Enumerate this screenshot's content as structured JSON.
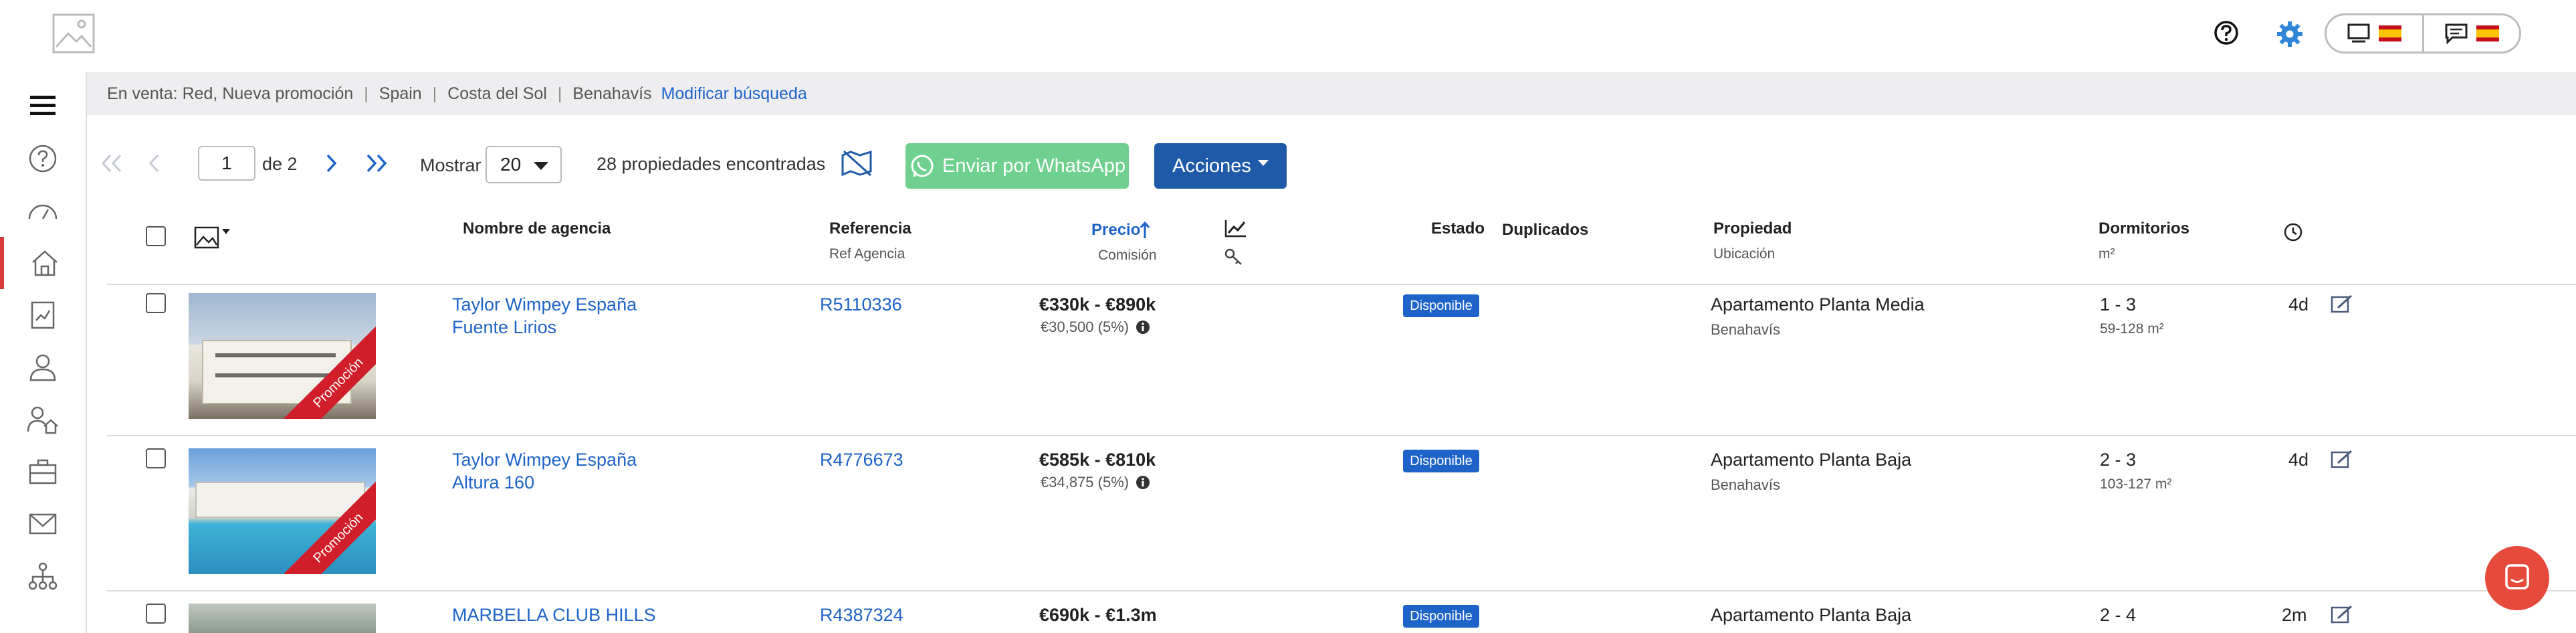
{
  "header": {
    "logo_icon": "image-placeholder-icon",
    "help_icon": "question-circle-icon",
    "settings_icon": "gear-icon",
    "toggle": [
      {
        "icon": "monitor-icon",
        "flag": "es"
      },
      {
        "icon": "chat-icon",
        "flag": "es"
      }
    ]
  },
  "sidebar": {
    "items": [
      "menu-icon",
      "help-icon",
      "dashboard-icon",
      "home-icon",
      "report-icon",
      "user-icon",
      "user-home-icon",
      "briefcase-icon",
      "mail-icon",
      "network-icon"
    ],
    "active": "home-icon"
  },
  "filter": {
    "parts": [
      "En venta: Red, Nueva promoción",
      "Spain",
      "Costa del Sol",
      "Benahavís"
    ],
    "link": "Modificar búsqueda"
  },
  "toolbar": {
    "page": "1",
    "of_label": "de 2",
    "show_label": "Mostrar",
    "show_value": "20",
    "count_label": "28 propiedades encontradas",
    "whatsapp_label": "Enviar por WhatsApp",
    "actions_label": "Acciones"
  },
  "columns": {
    "agency": "Nombre de agencia",
    "reference": "Referencia",
    "reference_sub": "Ref Agencia",
    "price": "Precio",
    "price_sub": "Comisión",
    "status": "Estado",
    "duplicates": "Duplicados",
    "property": "Propiedad",
    "property_sub": "Ubicación",
    "bedrooms": "Dormitorios",
    "bedrooms_sub": "m²"
  },
  "rows": [
    {
      "agency": "Taylor Wimpey España",
      "project": "Fuente Lirios",
      "ref": "R5110336",
      "price": "€330k - €890k",
      "commission": "€30,500 (5%)",
      "status": "Disponible",
      "property": "Apartamento Planta Media",
      "location": "Benahavís",
      "beds": "1 - 3",
      "area": "59-128 m²",
      "age": "4d",
      "ribbon": "Promoción"
    },
    {
      "agency": "Taylor Wimpey España",
      "project": "Altura 160",
      "ref": "R4776673",
      "price": "€585k - €810k",
      "commission": "€34,875 (5%)",
      "status": "Disponible",
      "property": "Apartamento Planta Baja",
      "location": "Benahavís",
      "beds": "2 - 3",
      "area": "103-127 m²",
      "age": "4d",
      "ribbon": "Promoción"
    },
    {
      "agency": "MARBELLA CLUB HILLS",
      "project": "",
      "ref": "R4387324",
      "price": "€690k - €1.3m",
      "commission": "",
      "status": "Disponible",
      "property": "Apartamento Planta Baja",
      "location": "",
      "beds": "2 - 4",
      "area": "",
      "age": "2m",
      "ribbon": ""
    }
  ],
  "colors": {
    "accent": "#1e64c8",
    "whatsapp": "#6fd08f",
    "actions": "#1e5aa8",
    "active_bar": "#d83b3b",
    "ribbon": "#d01f2a",
    "chat": "#e64a3c"
  }
}
